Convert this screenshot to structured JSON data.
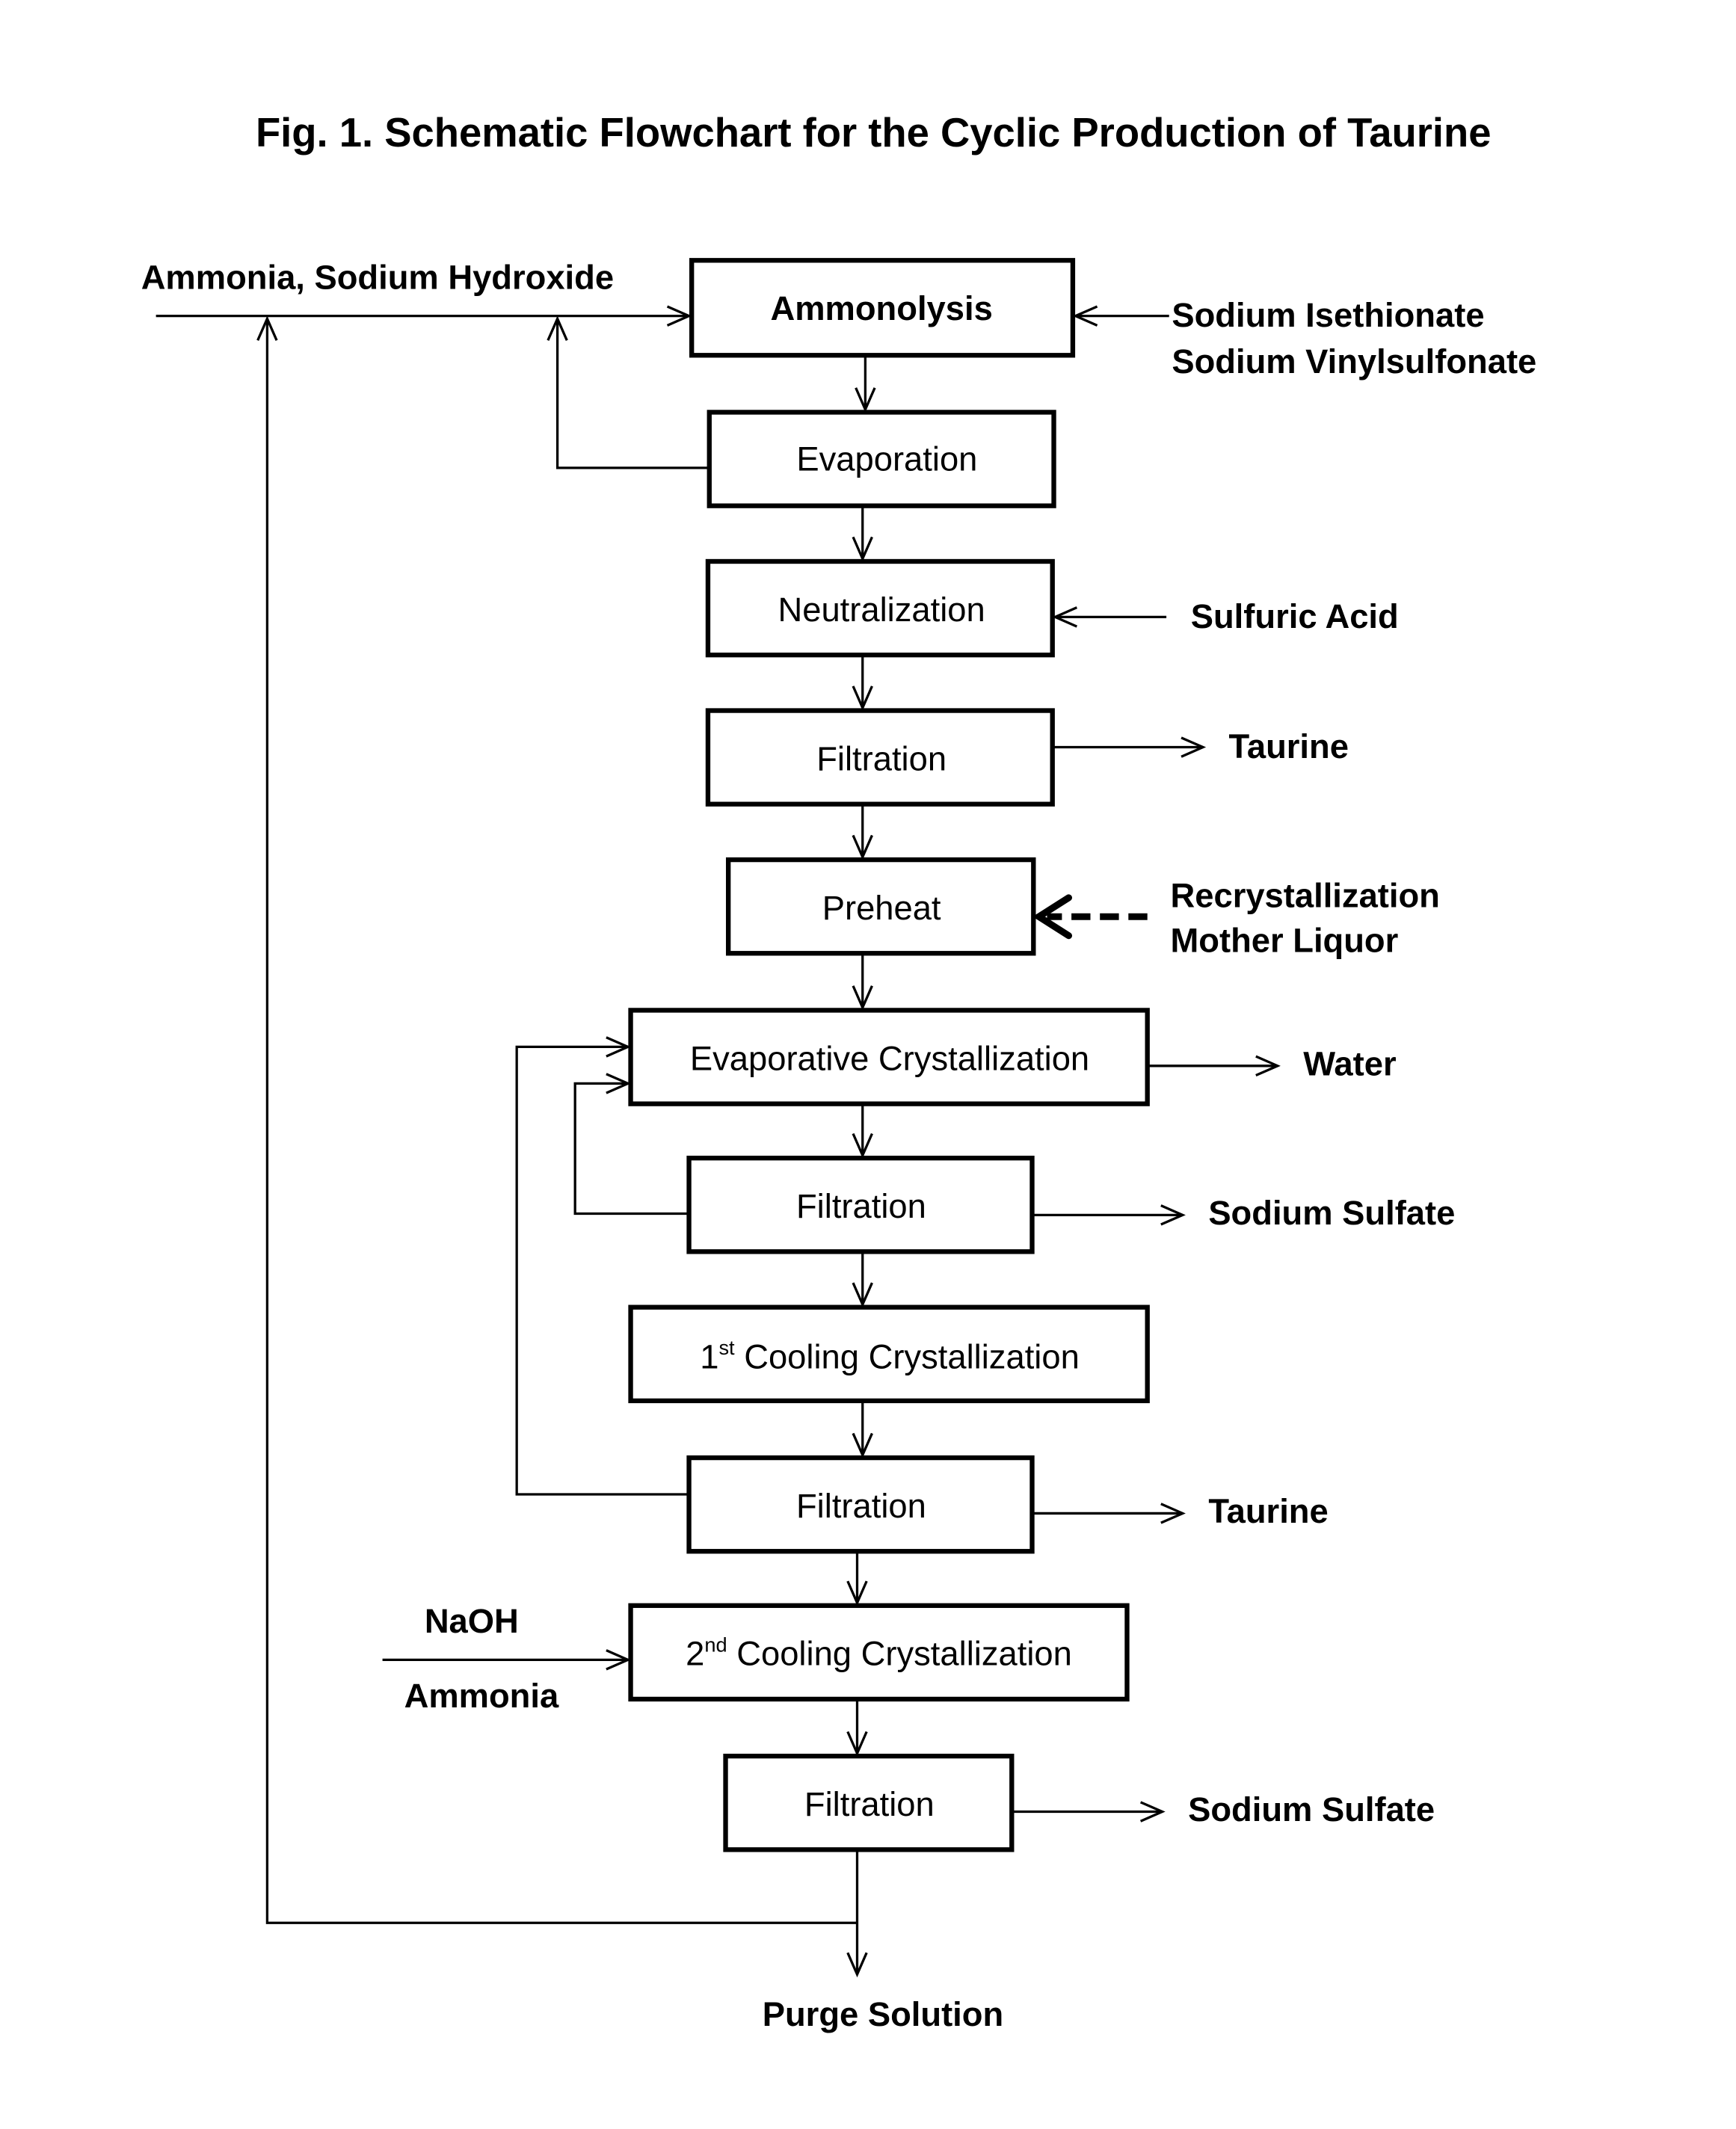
{
  "figure": {
    "title": "Fig. 1. Schematic Flowchart for the Cyclic Production of Taurine"
  },
  "steps": [
    {
      "id": "ammonolysis",
      "label": "Ammonolysis",
      "bold": true
    },
    {
      "id": "evaporation",
      "label": "Evaporation"
    },
    {
      "id": "neutralization",
      "label": "Neutralization"
    },
    {
      "id": "filtration-1",
      "label": "Filtration"
    },
    {
      "id": "preheat",
      "label": "Preheat"
    },
    {
      "id": "evaporative-crystallization",
      "label": "Evaporative Crystallization"
    },
    {
      "id": "filtration-2",
      "label": "Filtration"
    },
    {
      "id": "cooling-crystallization-1",
      "label_prefix": "1",
      "label_sup": "st",
      "label": "Cooling Crystallization"
    },
    {
      "id": "filtration-3",
      "label": "Filtration"
    },
    {
      "id": "cooling-crystallization-2",
      "label_prefix": "2",
      "label_sup": "nd",
      "label": "Cooling Crystallization"
    },
    {
      "id": "filtration-4",
      "label": "Filtration"
    }
  ],
  "inputs": {
    "ammonia_naoh": "Ammonia, Sodium Hydroxide",
    "sodium_isethionate": "Sodium Isethionate",
    "sodium_vinylsulfonate": "Sodium Vinylsulfonate",
    "sulfuric_acid": "Sulfuric Acid",
    "recrystallization": "Recrystallization",
    "mother_liquor": "Mother Liquor",
    "naoh": "NaOH",
    "ammonia": "Ammonia"
  },
  "outputs": {
    "taurine_1": "Taurine",
    "water": "Water",
    "sodium_sulfate_1": "Sodium Sulfate",
    "taurine_2": "Taurine",
    "sodium_sulfate_2": "Sodium Sulfate",
    "purge": "Purge Solution"
  }
}
